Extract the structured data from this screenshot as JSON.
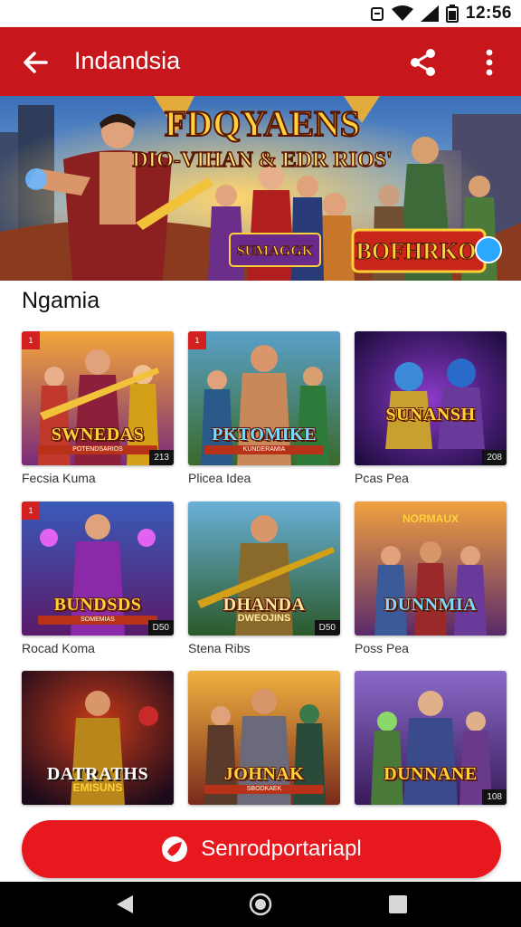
{
  "status_bar": {
    "time": "12:56"
  },
  "app_bar": {
    "title": "Indandsia"
  },
  "banner": {
    "title": "FDQYAENS",
    "subtitle": "DIO-VIHAN & EDR RIOS'",
    "logo_left": "SUMAGGK",
    "logo_right": "BOFHRKO"
  },
  "section": {
    "title": "Ngamia"
  },
  "games": [
    {
      "art_title": "SWNEDAS",
      "art_sub": "POTENDSARIOS",
      "label": "Fecsia Kuma",
      "tl": "1",
      "tr": "",
      "br": "213"
    },
    {
      "art_title": "PKTOMIKE",
      "art_sub": "KUNDERAMIA",
      "label": "Plicea Idea",
      "tl": "1",
      "tr": "",
      "br": ""
    },
    {
      "art_title": "SUNANSH",
      "art_sub": "",
      "label": "Pcas Pea",
      "tl": "",
      "tr": "",
      "br": "208"
    },
    {
      "art_title": "BUNDSDS",
      "art_sub": "SOMEMIAS",
      "label": "Rocad Koma",
      "tl": "1",
      "tr": "",
      "br": "D50"
    },
    {
      "art_title": "DHANDA",
      "art_sub": "DWEOJINS",
      "label": "Stena Ribs",
      "tl": "",
      "tr": "",
      "br": "D50"
    },
    {
      "art_title": "DUNNMIA",
      "art_sub": "NORMAUX",
      "label": "Poss Pea",
      "tl": "",
      "tr": "",
      "br": ""
    },
    {
      "art_title": "DATRATHS",
      "art_sub": "EMISUNS",
      "label": "",
      "tl": "",
      "tr": "",
      "br": ""
    },
    {
      "art_title": "JOHNAK",
      "art_sub": "SBODKAEK",
      "label": "",
      "tl": "",
      "tr": "",
      "br": ""
    },
    {
      "art_title": "DUNNANE",
      "art_sub": "",
      "label": "",
      "tl": "",
      "tr": "",
      "br": "108"
    }
  ],
  "cta": {
    "label": "Senrodportariapl"
  },
  "colors": {
    "primary": "#c8161d",
    "cta": "#e8181f"
  },
  "icons": [
    "back-arrow-icon",
    "share-icon",
    "more-vert-icon",
    "rocket-icon",
    "nav-back-icon",
    "nav-home-icon",
    "nav-recents-icon"
  ]
}
